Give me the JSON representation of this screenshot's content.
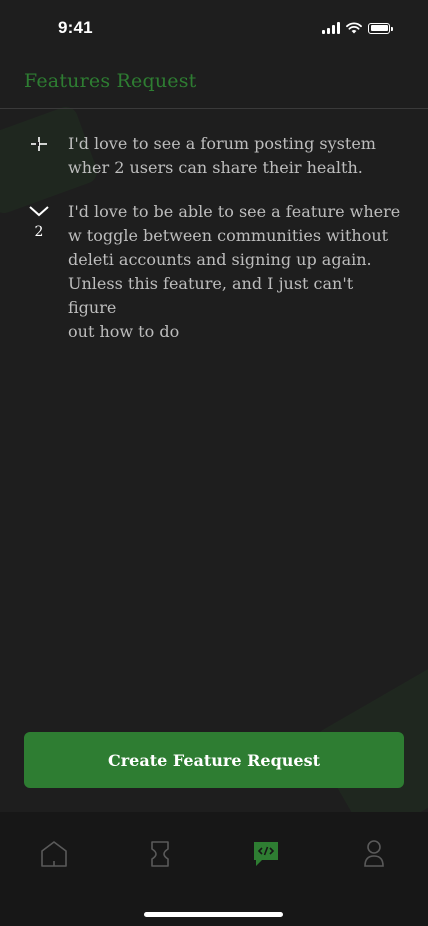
{
  "status_bar": {
    "time": "9:41"
  },
  "header": {
    "title": "Features Request"
  },
  "requests": [
    {
      "vote_icon": "upvote-plus-icon",
      "votes": "",
      "text": "I'd love to see a forum posting system\nwher 2 users can share their health."
    },
    {
      "vote_icon": "chevron-down-icon",
      "votes": "2",
      "text": "I'd love to be able to see a feature where\n w toggle between communities without\ndeleti accounts and signing up again.\nUnless this feature, and I just can't figure\nout how to do"
    }
  ],
  "cta": {
    "label": "Create Feature Request"
  },
  "tab_bar": {
    "tabs": [
      {
        "icon": "home-icon",
        "active": false
      },
      {
        "icon": "hourglass-icon",
        "active": false
      },
      {
        "icon": "code-chat-icon",
        "active": true
      },
      {
        "icon": "profile-icon",
        "active": false
      }
    ]
  },
  "colors": {
    "accent": "#2e7d32",
    "background": "#1e1e1e",
    "tab_bar": "#171717",
    "text": "#bdbdbd"
  }
}
